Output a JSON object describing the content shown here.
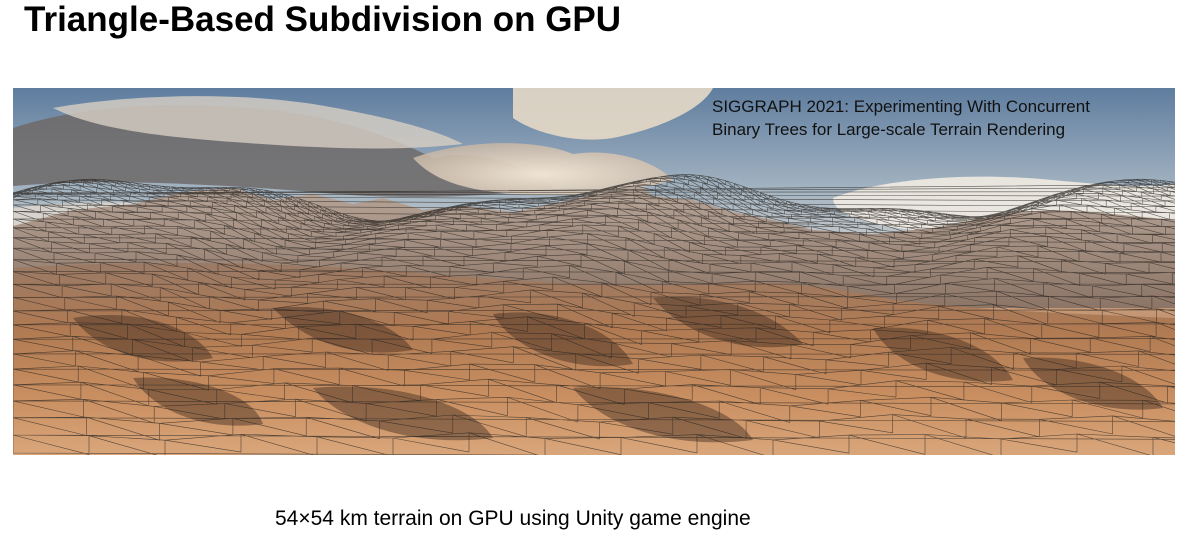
{
  "slide": {
    "title": "Triangle-Based Subdivision on GPU",
    "image_caption": {
      "line1": "SIGGRAPH 2021: Experimenting With Concurrent",
      "line2": "Binary Trees for Large-scale Terrain Rendering"
    },
    "footer_caption": "54×54 km terrain on GPU using Unity game engine"
  },
  "colors": {
    "sky_top": "#5f7d9f",
    "sky_light": "#d8dde0",
    "cloud": "#e8dccb",
    "cloud_shadow": "#8a7f77",
    "terrain_light": "#d6a276",
    "terrain_mid": "#b07a52",
    "terrain_dark": "#5a3d2e",
    "mountain_far": "#9c8a80",
    "wireframe": "#2a2522"
  }
}
